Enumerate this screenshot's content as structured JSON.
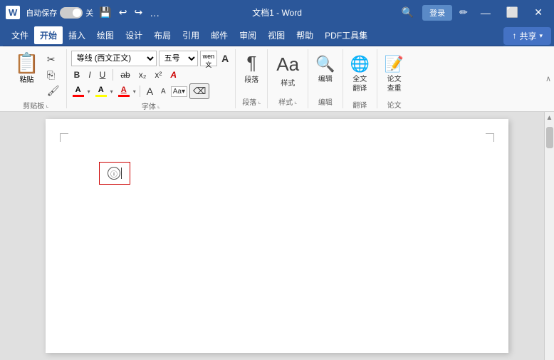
{
  "titlebar": {
    "word_icon": "W",
    "autosave_label": "自动保存",
    "toggle_state": "off",
    "toggle_label": "关",
    "save_icon": "💾",
    "undo_icon": "↩",
    "redo_icon": "↪",
    "more_icon": "…",
    "title": "文档1 - Word",
    "search_icon": "🔍",
    "login_label": "登录",
    "customize_icon": "✏",
    "minimize_icon": "—",
    "restore_icon": "⬜",
    "close_icon": "✕",
    "share_label": "共享",
    "share_arrow": "▾"
  },
  "menubar": {
    "items": [
      {
        "label": "文件",
        "active": false
      },
      {
        "label": "开始",
        "active": true
      },
      {
        "label": "插入",
        "active": false
      },
      {
        "label": "绘图",
        "active": false
      },
      {
        "label": "设计",
        "active": false
      },
      {
        "label": "布局",
        "active": false
      },
      {
        "label": "引用",
        "active": false
      },
      {
        "label": "邮件",
        "active": false
      },
      {
        "label": "审阅",
        "active": false
      },
      {
        "label": "视图",
        "active": false
      },
      {
        "label": "帮助",
        "active": false
      },
      {
        "label": "PDF工具集",
        "active": false
      }
    ]
  },
  "ribbon": {
    "groups": [
      {
        "name": "clipboard",
        "label": "剪贴板",
        "expand": true
      },
      {
        "name": "font",
        "label": "字体",
        "font_name": "等线 (西文正文)",
        "font_size": "五号",
        "expand": true
      },
      {
        "name": "paragraph",
        "label": "段落",
        "expand": true
      },
      {
        "name": "styles",
        "label": "样式",
        "expand": true
      },
      {
        "name": "editing",
        "label": "编辑",
        "expand": true
      },
      {
        "name": "translate",
        "label": "翻译",
        "sub_label1": "全文",
        "sub_label2": "翻译"
      },
      {
        "name": "paper",
        "label": "论文",
        "sub_label1": "论文",
        "sub_label2": "查重"
      }
    ],
    "collapse_arrow": "∧"
  },
  "document": {
    "page_title": "",
    "cursor_char": "ⓘ"
  },
  "colors": {
    "word_blue": "#2b579a",
    "font_color_red": "#FF0000",
    "highlight_yellow": "#FFFF00",
    "font_underline_red": "#FF0000",
    "accent": "#4472c4",
    "border_red": "#cc0000"
  }
}
